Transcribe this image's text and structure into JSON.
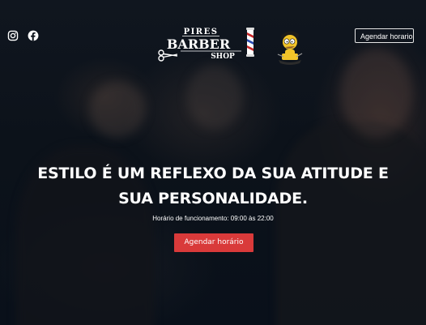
{
  "header": {
    "social": [
      {
        "icon": "instagram-icon"
      },
      {
        "icon": "facebook-icon"
      }
    ],
    "logo": {
      "line1": "PIRES",
      "line2": "BARBER",
      "line3": "SHOP"
    },
    "cta_label": "Agendar horario"
  },
  "hero": {
    "headline_line1": "ESTILO É UM REFLEXO DA SUA ATITUDE E",
    "headline_line2": "SUA PERSONALIDADE.",
    "hours": "Horário de funcionamento: 09:00 às 22:00",
    "cta_label": "Agendar horário"
  },
  "colors": {
    "accent": "#d93a3a",
    "background": "#0b1119",
    "text": "#ffffff"
  }
}
